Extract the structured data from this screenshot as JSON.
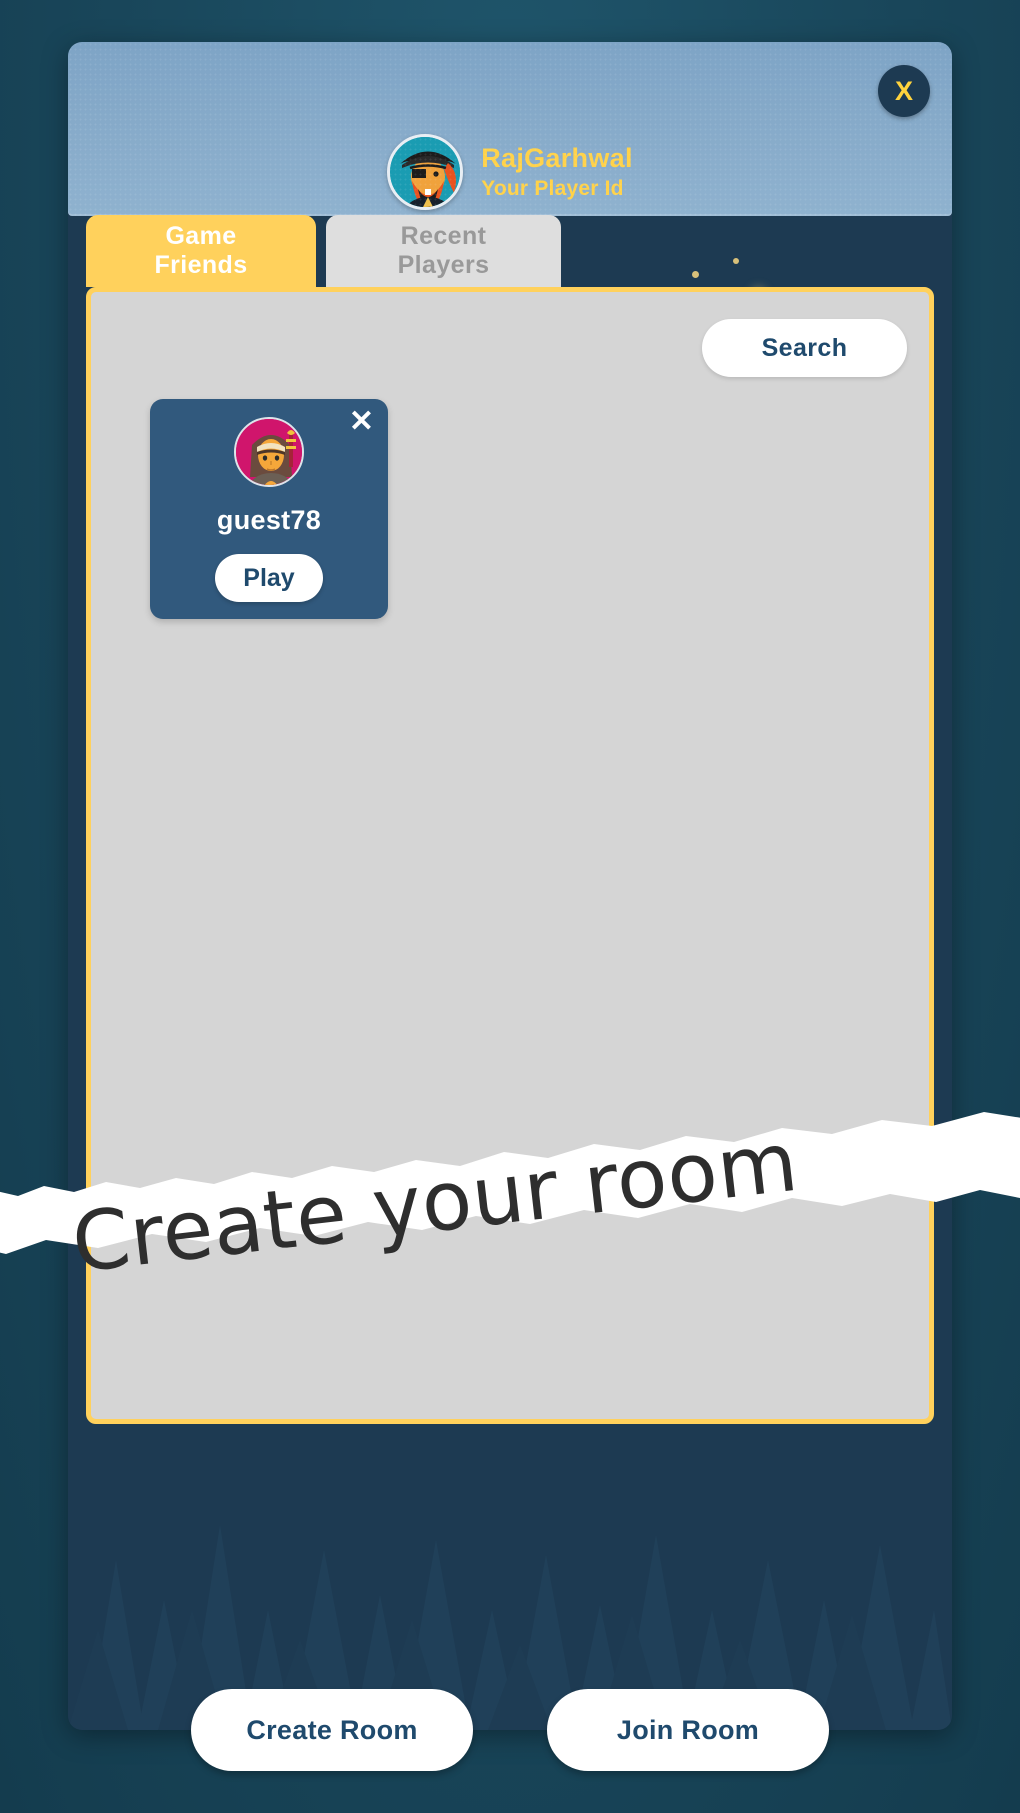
{
  "window": {
    "background_color": "#1b4a5e",
    "panel_color": "#1d3a52"
  },
  "header": {
    "close_label": "X",
    "avatar_icon": "pirate-avatar-icon",
    "player_name": "RajGarhwal",
    "player_subtitle": "Your Player Id",
    "accent_color": "#ffd24a"
  },
  "tabs": [
    {
      "label": "Game Friends",
      "active": true
    },
    {
      "label": "Recent Players",
      "active": false
    }
  ],
  "content": {
    "search_label": "Search",
    "background_color": "#d5d5d5",
    "border_color": "#ffd15c",
    "friends": [
      {
        "name": "guest78",
        "play_label": "Play",
        "remove_label": "✕",
        "avatar_icon": "monk-avatar-icon",
        "avatar_bg": "#d0156c"
      }
    ]
  },
  "banner": {
    "text": "Create your room",
    "text_color": "#2e2e2e",
    "paper_color": "#ffffff"
  },
  "footer": {
    "buttons": [
      {
        "label": "Create Room"
      },
      {
        "label": "Join Room"
      }
    ],
    "text_color": "#1f4a6d"
  }
}
